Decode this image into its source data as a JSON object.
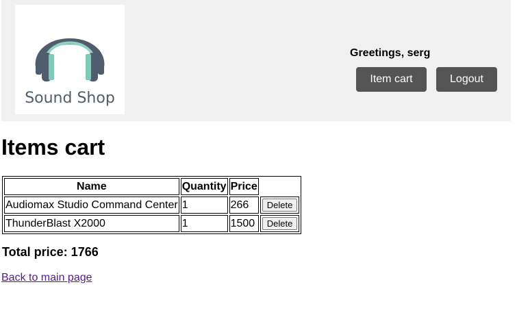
{
  "header": {
    "logo_text": "Sound Shop",
    "logo_icon": "headphones-icon",
    "greeting": "Greetings, serg",
    "item_cart_label": "Item cart",
    "logout_label": "Logout"
  },
  "main": {
    "title": "Items cart",
    "table": {
      "columns": [
        "Name",
        "Quantity",
        "Price"
      ],
      "rows": [
        {
          "name": "Audiomax Studio Command Center",
          "quantity": "1",
          "price": "266",
          "action": "Delete"
        },
        {
          "name": "ThunderBlast X2000",
          "quantity": "1",
          "price": "1500",
          "action": "Delete"
        }
      ]
    },
    "total": "Total price: 1766",
    "back_link": "Back to main page"
  },
  "colors": {
    "header_bg": "#f0f0f0",
    "button_bg": "#545454",
    "logo_teal": "#7ecbb7",
    "logo_dark": "#4f5d6c",
    "visited_link": "#551a8b"
  }
}
